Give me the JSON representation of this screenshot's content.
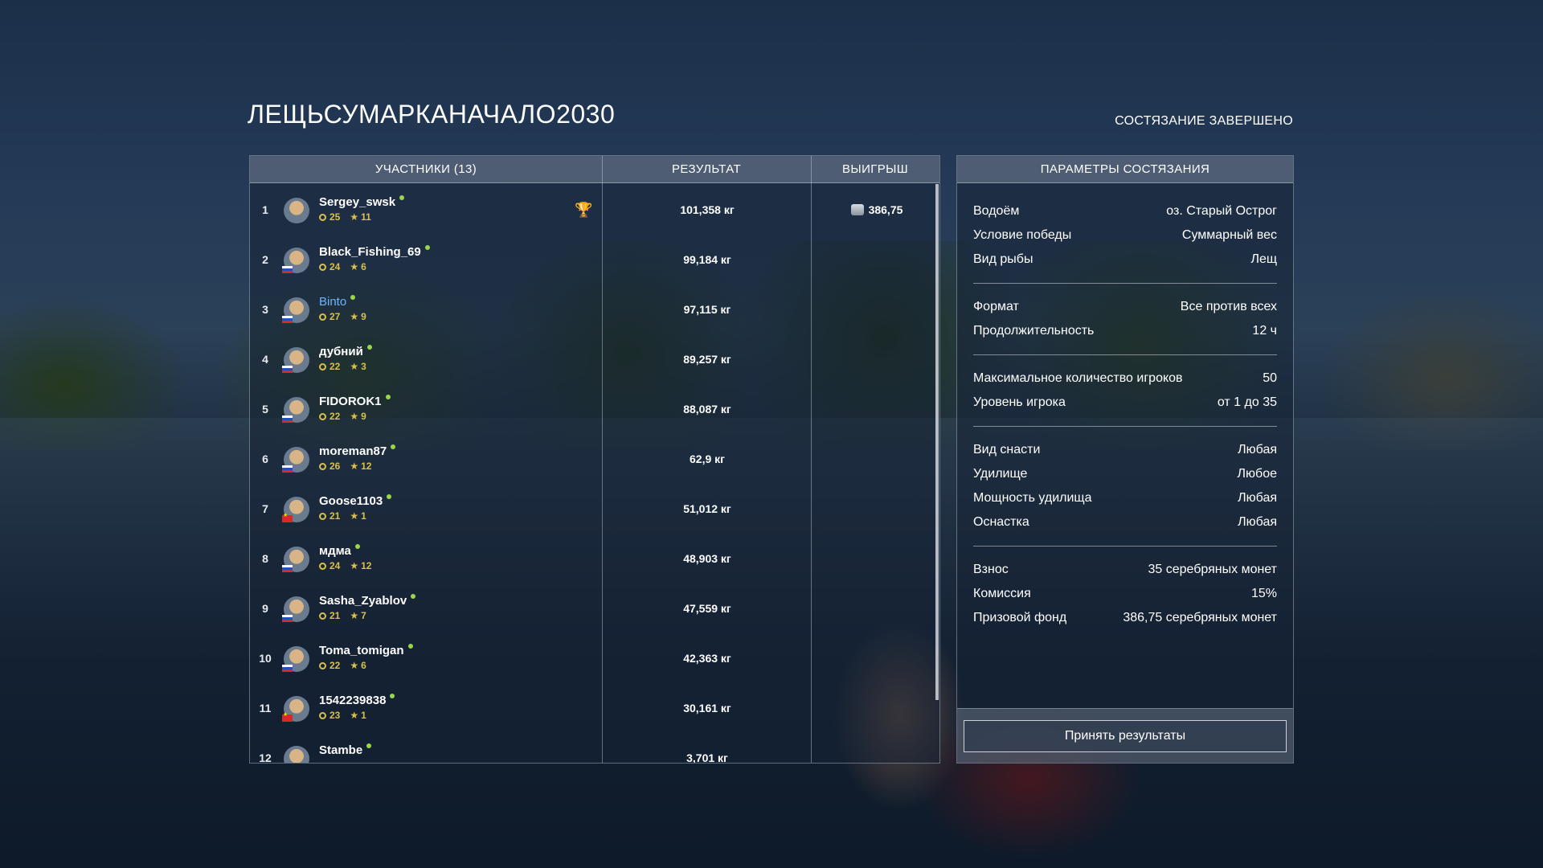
{
  "competition": {
    "title": "ЛЕЩЬСУМАРКАНАЧАЛО2030",
    "status": "СОСТЯЗАНИЕ ЗАВЕРШЕНО"
  },
  "participants_table": {
    "headers": {
      "participants": "УЧАСТНИКИ (13)",
      "result": "РЕЗУЛЬТАТ",
      "prize": "ВЫИГРЫШ"
    },
    "rows": [
      {
        "rank": "1",
        "name": "Sergey_swsk",
        "level": "25",
        "stars": "11",
        "result": "101,358 кг",
        "prize": "386,75",
        "flag": "none",
        "highlight": false
      },
      {
        "rank": "2",
        "name": "Black_Fishing_69",
        "level": "24",
        "stars": "6",
        "result": "99,184 кг",
        "prize": "",
        "flag": "ru",
        "highlight": false
      },
      {
        "rank": "3",
        "name": "Binto",
        "level": "27",
        "stars": "9",
        "result": "97,115 кг",
        "prize": "",
        "flag": "ru",
        "highlight": true
      },
      {
        "rank": "4",
        "name": "дубний",
        "level": "22",
        "stars": "3",
        "result": "89,257 кг",
        "prize": "",
        "flag": "ru",
        "highlight": false
      },
      {
        "rank": "5",
        "name": "FIDOROK1",
        "level": "22",
        "stars": "9",
        "result": "88,087 кг",
        "prize": "",
        "flag": "ru",
        "highlight": false
      },
      {
        "rank": "6",
        "name": "moreman87",
        "level": "26",
        "stars": "12",
        "result": "62,9 кг",
        "prize": "",
        "flag": "ru",
        "highlight": false
      },
      {
        "rank": "7",
        "name": "Goose1103",
        "level": "21",
        "stars": "1",
        "result": "51,012 кг",
        "prize": "",
        "flag": "cn",
        "highlight": false
      },
      {
        "rank": "8",
        "name": "мдма",
        "level": "24",
        "stars": "12",
        "result": "48,903 кг",
        "prize": "",
        "flag": "ru",
        "highlight": false
      },
      {
        "rank": "9",
        "name": "Sasha_Zyablov",
        "level": "21",
        "stars": "7",
        "result": "47,559 кг",
        "prize": "",
        "flag": "ru",
        "highlight": false
      },
      {
        "rank": "10",
        "name": "Toma_tomigan",
        "level": "22",
        "stars": "6",
        "result": "42,363 кг",
        "prize": "",
        "flag": "ru",
        "highlight": false
      },
      {
        "rank": "11",
        "name": "1542239838",
        "level": "23",
        "stars": "1",
        "result": "30,161 кг",
        "prize": "",
        "flag": "cn",
        "highlight": false
      },
      {
        "rank": "12",
        "name": "Stambe",
        "level": "",
        "stars": "",
        "result": "3,701 кг",
        "prize": "",
        "flag": "none",
        "highlight": false
      }
    ]
  },
  "parameters": {
    "header": "ПАРАМЕТРЫ СОСТЯЗАНИЯ",
    "groups": [
      [
        {
          "label": "Водоём",
          "value": "оз. Старый Острог"
        },
        {
          "label": "Условие победы",
          "value": "Суммарный вес"
        },
        {
          "label": "Вид рыбы",
          "value": "Лещ"
        }
      ],
      [
        {
          "label": "Формат",
          "value": "Все против всех"
        },
        {
          "label": "Продолжительность",
          "value": "12 ч"
        }
      ],
      [
        {
          "label": "Максимальное количество игроков",
          "value": "50"
        },
        {
          "label": "Уровень игрока",
          "value": "от 1 до 35"
        }
      ],
      [
        {
          "label": "Вид снасти",
          "value": "Любая"
        },
        {
          "label": "Удилище",
          "value": "Любое"
        },
        {
          "label": "Мощность удилища",
          "value": "Любая"
        },
        {
          "label": "Оснастка",
          "value": "Любая"
        }
      ],
      [
        {
          "label": "Взнос",
          "value": "35 серебряных монет"
        },
        {
          "label": "Комиссия",
          "value": "15%"
        },
        {
          "label": "Призовой фонд",
          "value": "386,75 серебряных монет"
        }
      ]
    ],
    "accept_label": "Принять результаты"
  },
  "icons": {
    "trophy": "trophy-icon",
    "coin": "silver-coin-icon",
    "level": "level-ring-icon",
    "star": "star-icon",
    "online": "online-dot-icon"
  },
  "colors": {
    "highlight_name": "#6fb3ff",
    "level_stat": "#d9c04a",
    "trophy": "#e8b22a",
    "online": "#9ad64a"
  }
}
